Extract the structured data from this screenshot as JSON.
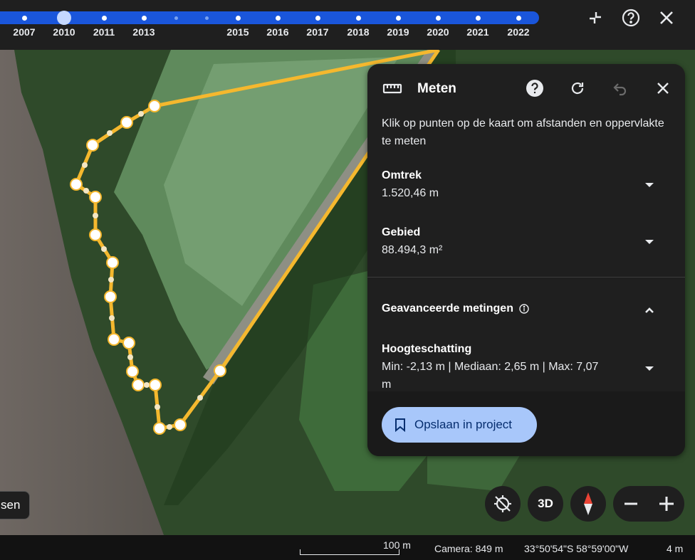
{
  "timeline": {
    "years": [
      "2007",
      "2010",
      "2011",
      "2013",
      "2015",
      "2016",
      "2017",
      "2018",
      "2019",
      "2020",
      "2021",
      "2022"
    ],
    "selected_year": "2010"
  },
  "top_icons": [
    "collapse-icon",
    "help-icon",
    "close-icon"
  ],
  "panel": {
    "title": "Meten",
    "instructions": "Klik op punten op de kaart om afstanden en oppervlakte te meten",
    "perimeter_label": "Omtrek",
    "perimeter_value": "1.520,46 m",
    "area_label": "Gebied",
    "area_value": "88.494,3 m²",
    "advanced_label": "Geavanceerde metingen",
    "height_label": "Hoogteschatting",
    "height_value": "Min: -2,13 m | Mediaan: 2,65 m | Max: 7,07 m",
    "save_button": "Opslaan in project"
  },
  "controls": {
    "three_d": "3D",
    "layer_button": "sen"
  },
  "status": {
    "scale": "100 m",
    "camera": "Camera: 849 m",
    "coordinates": "33°50'54\"S 58°59'00\"W",
    "elevation": "4 m"
  },
  "colors": {
    "accent": "#1a56db",
    "path": "#f5b82e",
    "save_button_bg": "#a8c7fa"
  }
}
